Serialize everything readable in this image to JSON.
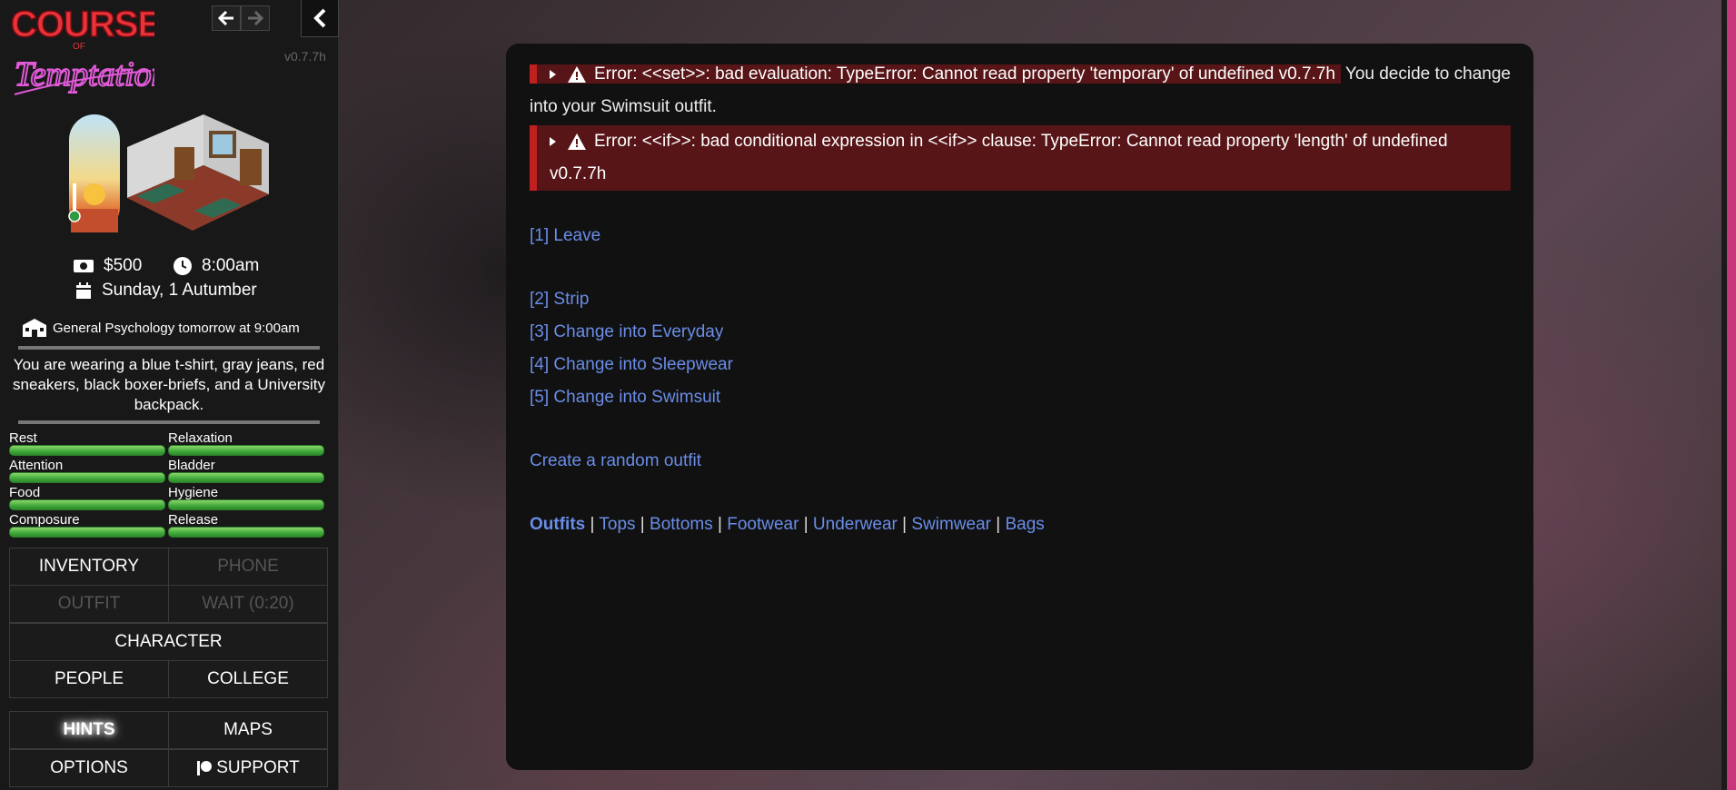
{
  "app": {
    "logo_line1": "COURSE",
    "logo_of": "OF",
    "logo_line2": "Temptation",
    "version": "v0.7.7h"
  },
  "status": {
    "money": "$500",
    "time": "8:00am",
    "date": "Sunday, 1 Autumber",
    "class_notice": "General Psychology tomorrow at 9:00am",
    "wearing": "You are wearing a blue t-shirt, gray jeans, red sneakers, black boxer-briefs, and a University backpack."
  },
  "meters": [
    {
      "label": "Rest",
      "level": 1.0
    },
    {
      "label": "Relaxation",
      "level": 1.0
    },
    {
      "label": "Attention",
      "level": 1.0
    },
    {
      "label": "Bladder",
      "level": 1.0
    },
    {
      "label": "Food",
      "level": 1.0
    },
    {
      "label": "Hygiene",
      "level": 1.0
    },
    {
      "label": "Composure",
      "level": 1.0
    },
    {
      "label": "Release",
      "level": 1.0
    }
  ],
  "menu": {
    "inventory": "INVENTORY",
    "phone": "PHONE",
    "outfit": "OUTFIT",
    "wait": "WAIT (0:20)",
    "character": "CHARACTER",
    "people": "PEOPLE",
    "college": "COLLEGE",
    "hints": "HINTS",
    "maps": "MAPS",
    "options": "OPTIONS",
    "support": "SUPPORT"
  },
  "passage": {
    "error1": "Error: <<set>>: bad evaluation: TypeError: Cannot read property 'temporary' of undefined v0.7.7h",
    "after_error1": "You decide to change into your Swimsuit outfit.",
    "error2": "Error: <<if>>: bad conditional expression in <<if>> clause: TypeError: Cannot read property 'length' of undefined v0.7.7h",
    "links": {
      "leave": "[1] Leave",
      "strip": "[2] Strip",
      "everyday": "[3] Change into Everyday",
      "sleepwear": "[4] Change into Sleepwear",
      "swimsuit": "[5] Change into Swimsuit",
      "random": "Create a random outfit"
    },
    "categories": [
      "Outfits",
      "Tops",
      "Bottoms",
      "Footwear",
      "Underwear",
      "Swimwear",
      "Bags"
    ]
  },
  "colors": {
    "link": "#6a8de8",
    "error_bg": "#581517",
    "error_border": "#c02020",
    "meter_green": "#3fa83a",
    "edge_pink": "#c8357a"
  }
}
